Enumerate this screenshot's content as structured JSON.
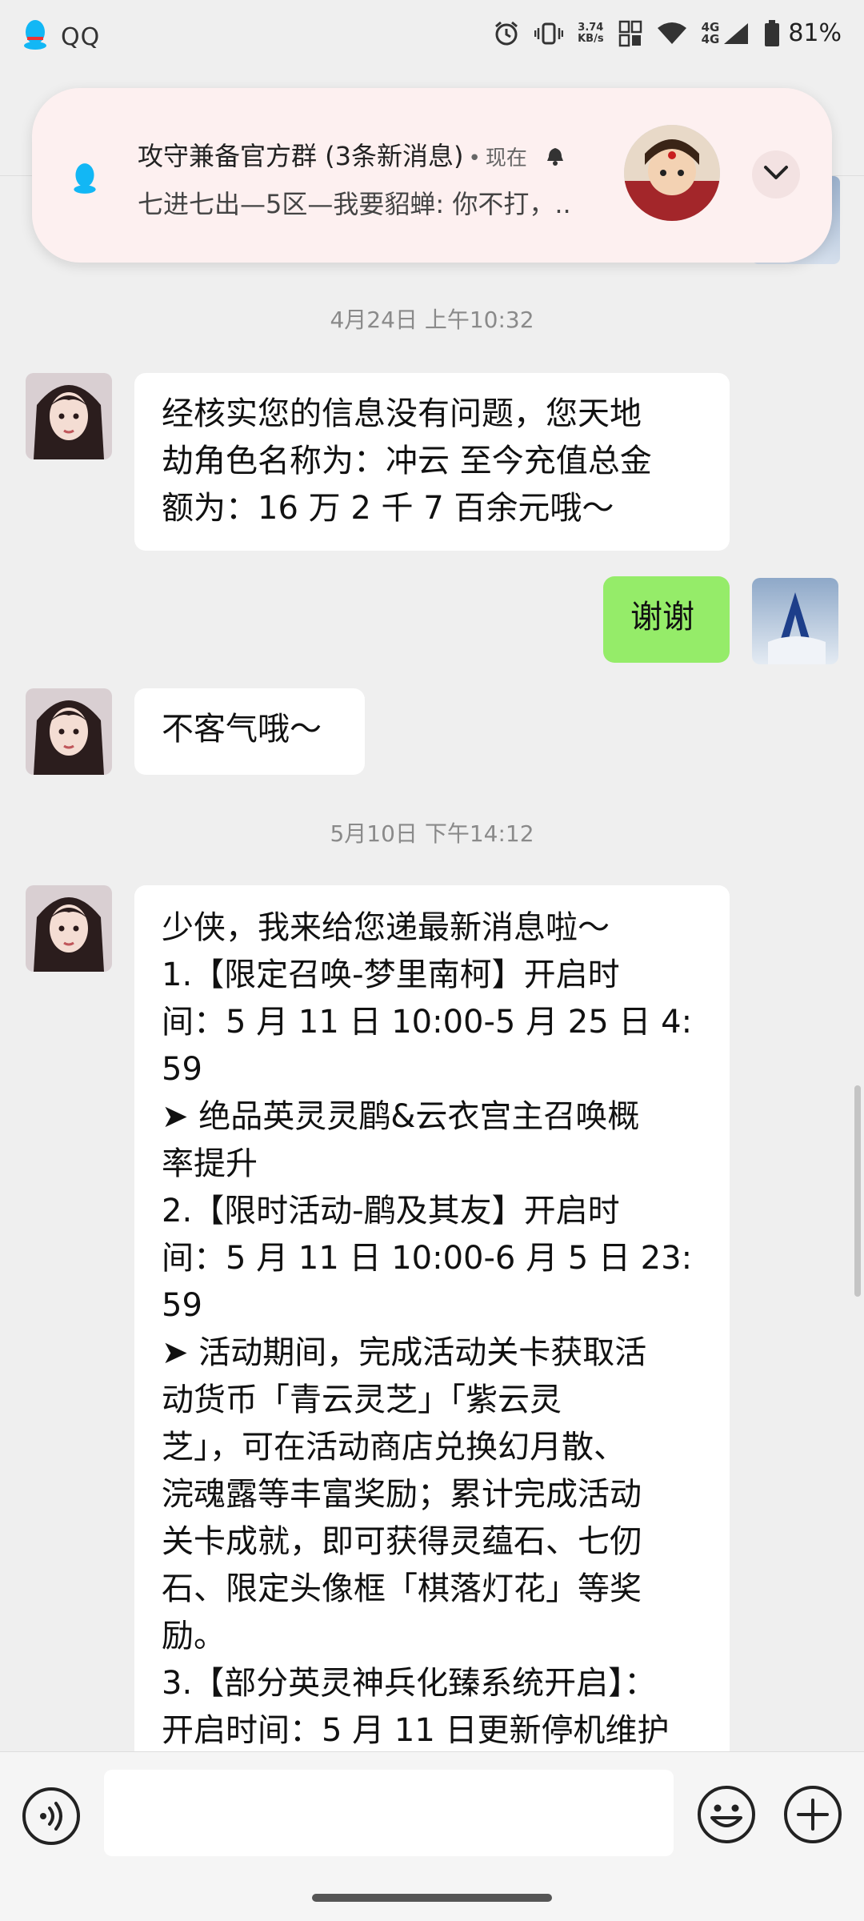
{
  "status_bar": {
    "app_name": "QQ",
    "net_speed_value": "3.74",
    "net_speed_unit": "KB/s",
    "net_type_top": "4G",
    "net_type_bottom": "4G",
    "battery_percent": "81%",
    "icons": [
      "qq-icon",
      "alarm-icon",
      "vibrate-icon",
      "speed-icon",
      "nfc-icon",
      "wifi-icon",
      "signal-icon",
      "battery-icon"
    ]
  },
  "notification": {
    "group_name": "攻守兼备官方群 (3条新消息)",
    "time": "现在",
    "body": "七进七出—5区—我要貂蝉: 你不打，..",
    "icons": [
      "qq-icon",
      "bell-icon",
      "chevron-down-icon"
    ]
  },
  "messages": {
    "time1": "4月24日 上午10:32",
    "m1_lines": [
      "经核实您的信息没有问题，您天地",
      "劫角色名称为：冲云 至今充值总金",
      "额为：16 万 2 千 7 百余元哦～"
    ],
    "m2": "谢谢",
    "m3": "不客气哦～",
    "time2": "5月10日 下午14:12",
    "m4_lines": [
      "少侠，我来给您递最新消息啦～",
      "1.【限定召唤-梦里南柯】开启时",
      "间：5 月 11 日 10:00-5 月 25 日 4:",
      "59",
      "➤ 绝品英灵灵鹛&云衣宫主召唤概",
      "率提升",
      "2.【限时活动-鹛及其友】开启时",
      "间：5 月 11 日 10:00-6 月 5 日 23:",
      "59",
      "➤ 活动期间，完成活动关卡获取活",
      "动货币「青云灵芝」「紫云灵",
      "芝」，可在活动商店兑换幻月散、",
      "浣魂露等丰富奖励；累计完成活动",
      "关卡成就，即可获得灵蕴石、七仞",
      "石、限定头像框「棋落灯花」等奖",
      "励。",
      "3.【部分英灵神兵化臻系统开启】：",
      "开启时间：5 月 11 日更新停机维护"
    ]
  },
  "input_bar": {
    "input_value": "",
    "icons": [
      "voice-icon",
      "emoji-icon",
      "plus-icon"
    ]
  }
}
